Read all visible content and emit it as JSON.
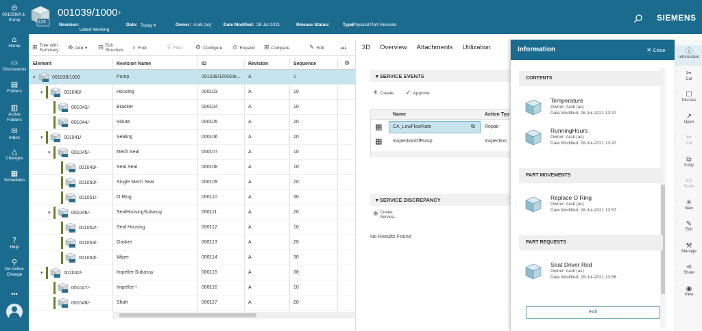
{
  "header": {
    "object_id": "001039/1000",
    "cube_label": "123",
    "revision_label": "Revision:",
    "revision_value": "Latest Working",
    "date_label": "Date:",
    "date_value": "Today",
    "owner_label": "Owner:",
    "owner_value": "Arati (as)",
    "date_modified_label": "Date Modified:",
    "date_modified_value": "28-Jul-2021",
    "release_status_label": "Release Status:",
    "release_status_value": "",
    "type_label": "Type:",
    "type_value": "Physical Part Revision",
    "brand": "SIEMENS"
  },
  "leftnav": {
    "back_label": "001039/A;1-Pump",
    "items": [
      {
        "label": "Home",
        "icon": "home-icon"
      },
      {
        "label": "Discussions",
        "icon": "discussions-icon"
      },
      {
        "label": "Folders",
        "icon": "folder-icon"
      },
      {
        "label": "Active Folders",
        "icon": "active-folder-icon"
      },
      {
        "label": "Inbox",
        "icon": "inbox-icon"
      },
      {
        "label": "Changes",
        "icon": "changes-icon"
      },
      {
        "label": "Schedules",
        "icon": "schedules-icon"
      }
    ],
    "help_label": "Help",
    "active_change_label": "No Active Change",
    "more_label": "•••"
  },
  "toolbar": {
    "tree_label": "Tree with Summary",
    "add_label": "Add",
    "edit_structure_label": "Edit Structure",
    "find_label": "Find",
    "filter_label": "Filter",
    "configure_label": "Configure",
    "expand_label": "Expand",
    "compare_label": "Compare",
    "edit_label": "Edit",
    "more_label": "•••"
  },
  "table": {
    "columns": [
      "Element",
      "Revision Name",
      "ID",
      "Revision",
      "Sequence"
    ],
    "rows": [
      {
        "element": "001039/1000",
        "name": "Pump",
        "id": "001039/1000Sie...",
        "rev": "A",
        "seq": "1",
        "level": 0,
        "toggle": "▾",
        "bar": false,
        "selected": true
      },
      {
        "element": "001040/-",
        "name": "Housing",
        "id": "000103",
        "rev": "A",
        "seq": "10",
        "level": 1,
        "toggle": "▾",
        "bar": true,
        "selected": false
      },
      {
        "element": "001043/-",
        "name": "Bracket",
        "id": "000104",
        "rev": "A",
        "seq": "10",
        "level": 2,
        "toggle": "",
        "bar": true,
        "selected": false
      },
      {
        "element": "001044/-",
        "name": "Volute",
        "id": "000105",
        "rev": "A",
        "seq": "20",
        "level": 2,
        "toggle": "",
        "bar": true,
        "selected": false
      },
      {
        "element": "001041/-",
        "name": "Sealing",
        "id": "000106",
        "rev": "A",
        "seq": "20",
        "level": 1,
        "toggle": "▾",
        "bar": true,
        "selected": false
      },
      {
        "element": "001045/-",
        "name": "Mech.Seal",
        "id": "000107",
        "rev": "A",
        "seq": "10",
        "level": 2,
        "toggle": "▾",
        "bar": true,
        "selected": false
      },
      {
        "element": "001049/-",
        "name": "Seal Seat",
        "id": "000108",
        "rev": "A",
        "seq": "10",
        "level": 3,
        "toggle": "",
        "bar": true,
        "selected": false
      },
      {
        "element": "001050/-",
        "name": "Single Mech Seat",
        "id": "000109",
        "rev": "A",
        "seq": "20",
        "level": 3,
        "toggle": "",
        "bar": true,
        "selected": false
      },
      {
        "element": "001051/-",
        "name": "O Ring",
        "id": "000110",
        "rev": "A",
        "seq": "30",
        "level": 3,
        "toggle": "",
        "bar": true,
        "selected": false
      },
      {
        "element": "001046/-",
        "name": "SealHousingSubassy",
        "id": "000111",
        "rev": "A",
        "seq": "20",
        "level": 2,
        "toggle": "▾",
        "bar": true,
        "selected": false
      },
      {
        "element": "001052/-",
        "name": "Seal Housing",
        "id": "000112",
        "rev": "A",
        "seq": "10",
        "level": 3,
        "toggle": "",
        "bar": true,
        "selected": false
      },
      {
        "element": "001053/-",
        "name": "Gasket",
        "id": "000113",
        "rev": "A",
        "seq": "20",
        "level": 3,
        "toggle": "",
        "bar": true,
        "selected": false
      },
      {
        "element": "001054/-",
        "name": "Wiper",
        "id": "000114",
        "rev": "A",
        "seq": "30",
        "level": 3,
        "toggle": "",
        "bar": true,
        "selected": false
      },
      {
        "element": "001042/-",
        "name": "Impeller Subassy",
        "id": "000115",
        "rev": "A",
        "seq": "30",
        "level": 1,
        "toggle": "▾",
        "bar": true,
        "selected": false
      },
      {
        "element": "001047/-",
        "name": "Impeller-I",
        "id": "000116",
        "rev": "A",
        "seq": "10",
        "level": 2,
        "toggle": "",
        "bar": true,
        "selected": false
      },
      {
        "element": "001048/-",
        "name": "Shaft",
        "id": "000117",
        "rev": "A",
        "seq": "20",
        "level": 2,
        "toggle": "",
        "bar": true,
        "selected": false
      }
    ]
  },
  "tabs": [
    "3D",
    "Overview",
    "Attachments",
    "Utilization"
  ],
  "service_events": {
    "title": "SERVICE EVENTS",
    "create_label": "Create",
    "approve_label": "Approve",
    "columns": [
      "Name",
      "Action Typ"
    ],
    "rows": [
      {
        "name": "CA_LowFlowRate",
        "action": "Repair"
      },
      {
        "name": "InspectionOfPump",
        "action": "Inspection"
      }
    ]
  },
  "service_discrepancy": {
    "title": "SERVICE DISCREPANCY",
    "create_label": "Create Service...",
    "empty_label": "No Results Found"
  },
  "info": {
    "title": "Information",
    "close_label": "Close",
    "contents_title": "CONTENTS",
    "contents": [
      {
        "name": "Temperature",
        "owner": "Owner:  Arati (as)",
        "date": "Date Modified:  28-Jul-2021 13:47"
      },
      {
        "name": "RunningHours",
        "owner": "Owner:  Arati (as)",
        "date": "Date Modified:  28-Jul-2021 13:47"
      }
    ],
    "movements_title": "PART MOVEMENTS",
    "movements": [
      {
        "name": "Replace O Ring",
        "owner": "Owner:  Arati (as)",
        "date": "Date Modified:  28-Jul-2021 13:57"
      }
    ],
    "requests_title": "PART REQUESTS",
    "requests": [
      {
        "name": "Seat Driver Rod",
        "owner": "Owner:  Arati (as)",
        "date": "Date Modified:  28-Jul-2021 13:56"
      }
    ],
    "edit_label": "Edit"
  },
  "cmdbar": [
    {
      "label": "Information",
      "icon": "info-icon",
      "glyph": "ⓘ",
      "dim": false,
      "active": true
    },
    {
      "label": "Cut",
      "icon": "cut-icon",
      "glyph": "✂",
      "dim": false,
      "active": false
    },
    {
      "label": "Discuss",
      "icon": "discuss-icon",
      "glyph": "☐",
      "dim": false,
      "active": false
    },
    {
      "label": "Open",
      "icon": "open-icon",
      "glyph": "↗",
      "dim": false,
      "active": false
    },
    {
      "label": "Cut",
      "icon": "cut-icon-2",
      "glyph": "✂",
      "dim": true,
      "active": false
    },
    {
      "label": "Copy",
      "icon": "copy-icon",
      "glyph": "⧉",
      "dim": false,
      "active": false
    },
    {
      "label": "Paste",
      "icon": "paste-icon",
      "glyph": "▭",
      "dim": true,
      "active": false
    },
    {
      "label": "New",
      "icon": "new-icon",
      "glyph": "✳",
      "dim": false,
      "active": false
    },
    {
      "label": "Edit",
      "icon": "edit-icon",
      "glyph": "✎",
      "dim": false,
      "active": false
    },
    {
      "label": "Manage",
      "icon": "manage-icon",
      "glyph": "⚒",
      "dim": false,
      "active": false
    },
    {
      "label": "Share",
      "icon": "share-icon",
      "glyph": "⋖",
      "dim": false,
      "active": false
    },
    {
      "label": "View",
      "icon": "view-icon",
      "glyph": "◉",
      "dim": false,
      "active": false
    }
  ],
  "colors": {
    "brand_teal": "#1b6b8e",
    "selected_row": "#c6e4ee",
    "tree_bar": "#6b7f2a"
  }
}
